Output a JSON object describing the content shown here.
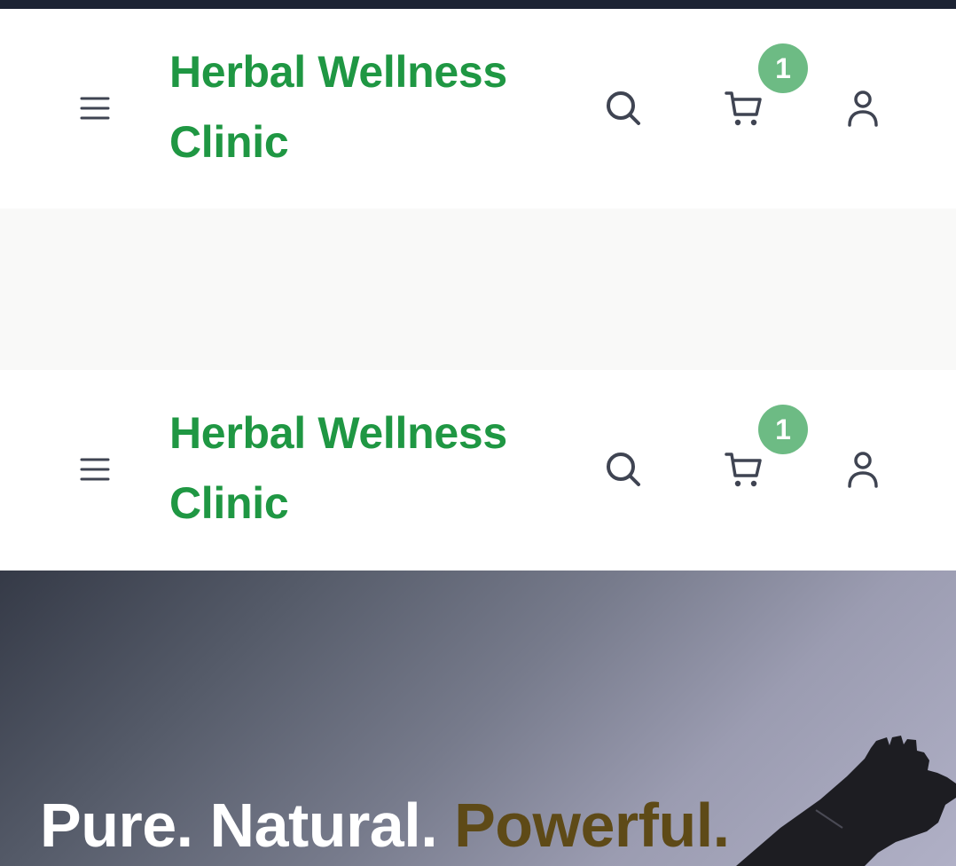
{
  "header": {
    "brand_line1": "Herbal Wellness",
    "brand_line2": "Clinic",
    "cart_count": "1",
    "icons": [
      "menu-icon",
      "search-icon",
      "cart-icon",
      "user-icon"
    ]
  },
  "hero": {
    "title_part1": "Pure. Natural.",
    "title_part2": "Powerful."
  },
  "colors": {
    "brand": "#1f9743",
    "badge": "#6dbb84",
    "accent": "#5e4a17",
    "icon": "#3f4452",
    "top_strip": "#1c2333"
  }
}
